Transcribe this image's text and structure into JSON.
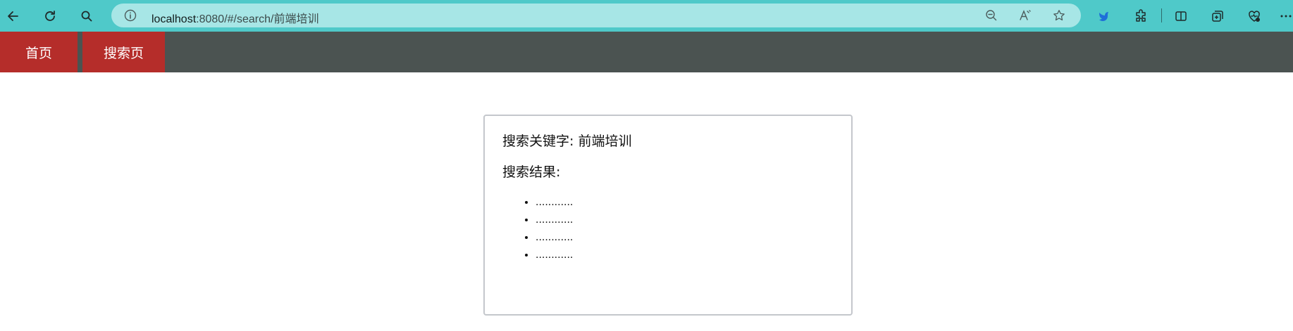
{
  "browser": {
    "url_host": "localhost",
    "url_path": ":8080/#/search/前端培训"
  },
  "nav": {
    "items": [
      {
        "label": "首页"
      },
      {
        "label": "搜索页"
      }
    ]
  },
  "card": {
    "keyword_label": "搜索关键字: 前端培训",
    "results_label": "搜索结果:",
    "results": [
      "............",
      "............",
      "............",
      "............"
    ]
  },
  "colors": {
    "browser_bar": "#4fc9c9",
    "nav_bg": "#4b5351",
    "nav_active": "#b52d2a"
  }
}
